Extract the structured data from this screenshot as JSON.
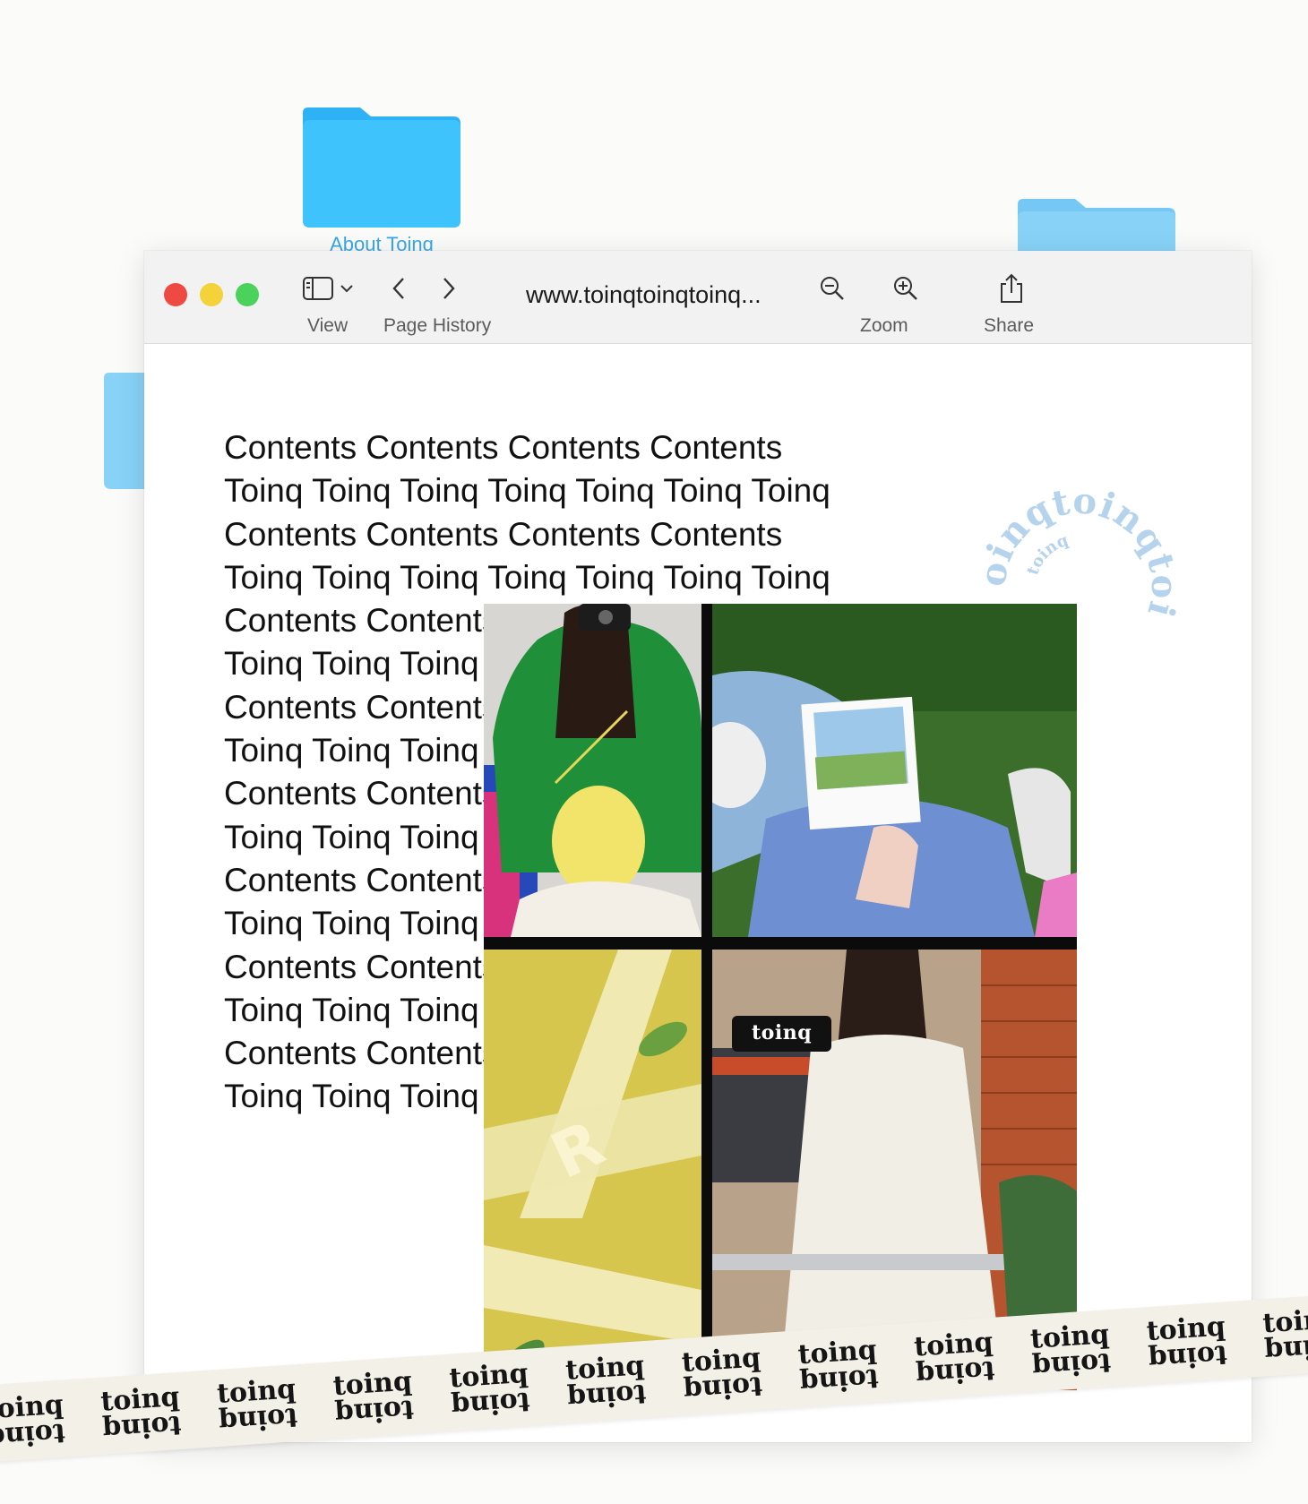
{
  "desktop": {
    "folders": [
      {
        "label": "About Toinq"
      }
    ]
  },
  "window": {
    "toolbar": {
      "view_label": "View",
      "history_label": "Page History",
      "url": "www.toinqtoinqtoinq...",
      "zoom_label": "Zoom",
      "share_label": "Share"
    },
    "content_lines": [
      "Contents Contents Contents Contents",
      "Toinq Toinq Toinq Toinq Toinq Toinq Toinq",
      "Contents Contents Contents Contents",
      "Toinq Toinq Toinq Toinq Toinq Toinq Toinq",
      "Contents Contents Contents Contents",
      "Toinq Toinq Toinq Toinq Toinq Toinq Toinq",
      "Contents Contents Contents Contents",
      "Toinq Toinq Toinq Toinq Toinq Toinq Toinq",
      "Contents Contents Contents Contents",
      "Toinq Toinq Toinq Toinq Toinq Toinq Toinq",
      "Contents Contents Contents Contents",
      "Toinq Toinq Toinq Toinq Toinq Toinq Toinq",
      "Contents Contents Contents Contents",
      "Toinq Toinq Toinq Toinq Toinq Toinq Toinq",
      "Contents Contents Contents Contents",
      "Toinq Toinq Toinq Toinq Toinq Toinq Toinq"
    ]
  },
  "stamp": {
    "outer_text": "toinqtoinqtoinq",
    "inner_text": "toinq"
  },
  "collage": {
    "tag_text": "toinq"
  },
  "tape": {
    "word": "toinq"
  },
  "colors": {
    "folder_blue": "#3fc3fd",
    "folder_blue_light": "#88d2f8",
    "close": "#ee4a43",
    "minimize": "#f4d23a",
    "maximize": "#4ad25c"
  }
}
